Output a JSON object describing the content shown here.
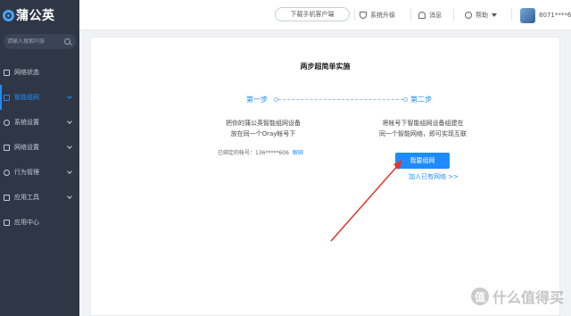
{
  "sidebar": {
    "brand": "蒲公英",
    "search_placeholder": "请输入搜索内容",
    "items": [
      {
        "label": "网络状态"
      },
      {
        "label": "智能组网"
      },
      {
        "label": "系统设置"
      },
      {
        "label": "网络设置"
      },
      {
        "label": "行为管理"
      },
      {
        "label": "应用工具"
      },
      {
        "label": "应用中心"
      }
    ]
  },
  "topbar": {
    "download_client": "下载手机客户端",
    "upgrade": "系统升级",
    "messages": "消息",
    "help": "帮助",
    "account": "8071****6"
  },
  "main": {
    "title": "两步超简单实施",
    "step1_label": "第一步",
    "step2_label": "第二步",
    "step1_desc_line1": "把你的蒲公英智能组网设备",
    "step1_desc_line2": "放在同一个Oray帐号下",
    "step2_desc_line1": "将帐号下智能组网设备组建在",
    "step2_desc_line2": "同一个智能网络，即可实现互联",
    "bound_label": "已绑定的帐号：",
    "bound_account": "136*****606",
    "unbind": "解绑",
    "primary_button": "我要组网",
    "join_link": "加入已有网络 >>"
  },
  "colors": {
    "accent": "#1e8cff",
    "sidebar_bg": "#2f3746",
    "arrow": "#e8322b"
  },
  "watermark": {
    "glyph": "值",
    "text": "什么值得买"
  }
}
